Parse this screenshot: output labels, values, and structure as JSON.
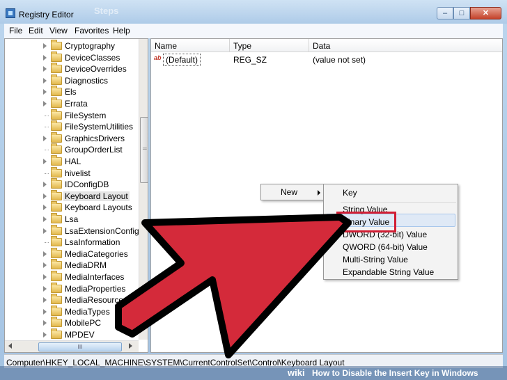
{
  "window": {
    "title": "Registry Editor",
    "ghost_title": "Steps"
  },
  "controls": {
    "minimize": "–",
    "maximize": "□",
    "close": "✕"
  },
  "menu": [
    "File",
    "Edit",
    "View",
    "Favorites",
    "Help"
  ],
  "tree": [
    {
      "label": "Cryptography",
      "expandable": true
    },
    {
      "label": "DeviceClasses",
      "expandable": true
    },
    {
      "label": "DeviceOverrides",
      "expandable": true
    },
    {
      "label": "Diagnostics",
      "expandable": true
    },
    {
      "label": "Els",
      "expandable": true
    },
    {
      "label": "Errata",
      "expandable": true
    },
    {
      "label": "FileSystem",
      "expandable": false
    },
    {
      "label": "FileSystemUtilities",
      "expandable": false
    },
    {
      "label": "GraphicsDrivers",
      "expandable": true
    },
    {
      "label": "GroupOrderList",
      "expandable": false
    },
    {
      "label": "HAL",
      "expandable": true
    },
    {
      "label": "hivelist",
      "expandable": false
    },
    {
      "label": "IDConfigDB",
      "expandable": true
    },
    {
      "label": "Keyboard Layout",
      "expandable": true,
      "selected": true
    },
    {
      "label": "Keyboard Layouts",
      "expandable": true
    },
    {
      "label": "Lsa",
      "expandable": true
    },
    {
      "label": "LsaExtensionConfig",
      "expandable": true
    },
    {
      "label": "LsaInformation",
      "expandable": false
    },
    {
      "label": "MediaCategories",
      "expandable": true
    },
    {
      "label": "MediaDRM",
      "expandable": true
    },
    {
      "label": "MediaInterfaces",
      "expandable": true
    },
    {
      "label": "MediaProperties",
      "expandable": true
    },
    {
      "label": "MediaResources",
      "expandable": true
    },
    {
      "label": "MediaTypes",
      "expandable": true
    },
    {
      "label": "MobilePC",
      "expandable": true
    },
    {
      "label": "MPDEV",
      "expandable": true
    }
  ],
  "scroll": {
    "grip": "III"
  },
  "columns": {
    "name": "Name",
    "type": "Type",
    "data": "Data"
  },
  "values": [
    {
      "icon": "ab",
      "name": "(Default)",
      "type": "REG_SZ",
      "data": "(value not set)"
    }
  ],
  "context_menu": {
    "new": "New"
  },
  "submenu": [
    "Key",
    "String Value",
    "Binary Value",
    "DWORD (32-bit) Value",
    "QWORD (64-bit) Value",
    "Multi-String Value",
    "Expandable String Value"
  ],
  "status": {
    "path": "Computer\\HKEY_LOCAL_MACHINE\\SYSTEM\\CurrentControlSet\\Control\\Keyboard Layout"
  },
  "watermark": {
    "brand": "wiki",
    "text": "How to Disable the Insert Key in Windows"
  },
  "colors": {
    "arrow": "#d42a3a",
    "highlight": "#d21e34",
    "selection": "#dfe9f6"
  }
}
